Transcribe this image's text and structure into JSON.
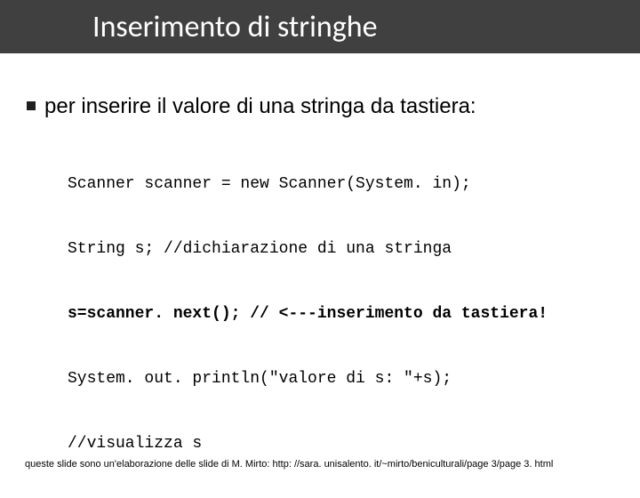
{
  "header": {
    "title": "Inserimento di stringhe"
  },
  "content": {
    "bullet": "per inserire il valore di una stringa da tastiera:",
    "code": {
      "line1": "Scanner scanner = new Scanner(System. in);",
      "line2": "String s; //dichiarazione di una stringa",
      "line3": "s=scanner. next(); // <---inserimento da tastiera!",
      "line4": "System. out. println(\"valore di s: \"+s);",
      "line5": "//visualizza s"
    }
  },
  "footer": {
    "text": "queste slide sono un'elaborazione delle slide di M. Mirto: http: //sara. unisalento. it/~mirto/beniculturali/page 3/page 3. html"
  }
}
